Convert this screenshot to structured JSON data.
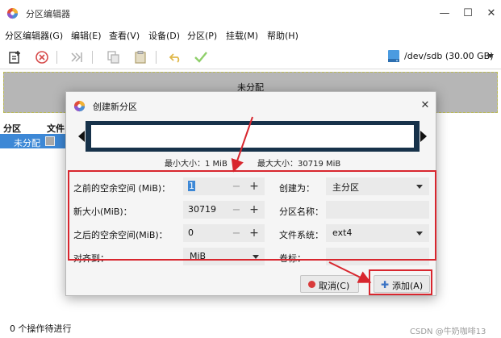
{
  "window": {
    "title": "分区编辑器",
    "controls": {
      "minimize": "—",
      "maximize": "☐",
      "close": "✕"
    }
  },
  "menubar": {
    "items": [
      "分区编辑器(G)",
      "编辑(E)",
      "查看(V)",
      "设备(D)",
      "分区(P)",
      "挂载(M)",
      "帮助(H)"
    ]
  },
  "toolbar": {
    "buttons": [
      "new-partition-icon",
      "delete-icon",
      "resize-icon",
      "copy-icon",
      "paste-icon",
      "undo-icon",
      "apply-icon"
    ],
    "device": "/dev/sdb (30.00 GB)"
  },
  "graph": {
    "label": "未分配"
  },
  "list": {
    "headers": {
      "partition": "分区",
      "filesystem": "文件"
    },
    "selected_row": {
      "label": "未分配"
    }
  },
  "status": {
    "text": "0 个操作待进行"
  },
  "watermark": "CSDN @牛奶咖啡13",
  "dialog": {
    "title": "创建新分区",
    "min_size": "最小大小：1 MiB",
    "max_size": "最大大小：30719 MiB",
    "form": {
      "space_before": {
        "label": "之前的空余空间 (MiB)：",
        "value": "1",
        "minus": "−",
        "plus": "+"
      },
      "new_size": {
        "label": "新大小(MiB)：",
        "value": "30719",
        "minus": "−",
        "plus": "+"
      },
      "space_after": {
        "label": "之后的空余空间(MiB)：",
        "value": "0",
        "minus": "−",
        "plus": "+"
      },
      "align_to": {
        "label": "对齐到：",
        "value": "MiB"
      },
      "create_as": {
        "label": "创建为：",
        "value": "主分区"
      },
      "partition_name": {
        "label": "分区名称：",
        "value": ""
      },
      "filesystem": {
        "label": "文件系统：",
        "value": "ext4"
      },
      "volume_label": {
        "label": "卷标：",
        "value": ""
      }
    },
    "buttons": {
      "cancel": "取消(C)",
      "add": "添加(A)"
    }
  },
  "colors": {
    "selection": "#3d88d6",
    "annotation": "#d8262e",
    "unallocated": "#b6b6b6",
    "resizer_border": "#17324a"
  }
}
